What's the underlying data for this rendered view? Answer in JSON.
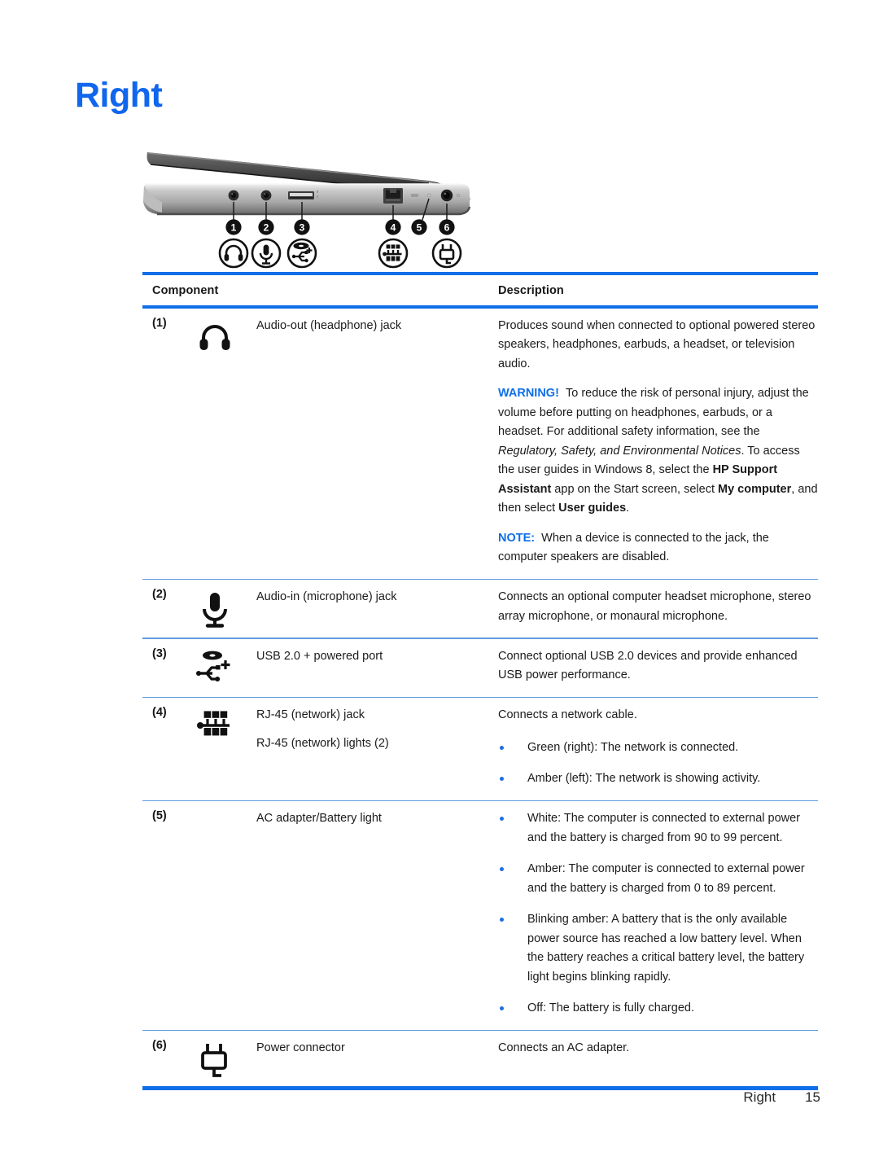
{
  "page": {
    "title": "Right",
    "title_color": "#1166EE",
    "accent_color": "#0E6FE8",
    "rule_color": "#5D9BE0",
    "footer_section": "Right",
    "footer_page_number": "15"
  },
  "illustration": {
    "alt": "Right side view of notebook computer showing six numbered callouts",
    "callouts": [
      "1",
      "2",
      "3",
      "4",
      "5",
      "6"
    ],
    "icon_names": [
      "headphone-icon",
      "microphone-icon",
      "usb-powered-icon",
      "rj45-network-icon",
      "power-connector-icon"
    ]
  },
  "table": {
    "headers": {
      "component": "Component",
      "description": "Description"
    },
    "rows": [
      {
        "callout": "(1)",
        "icon": "headphone-icon",
        "label": "Audio-out (headphone) jack",
        "label2": null,
        "paragraphs": [
          {
            "type": "plain",
            "text": "Produces sound when connected to optional powered stereo speakers, headphones, earbuds, a headset, or television audio."
          },
          {
            "type": "warning",
            "tag": "WARNING!",
            "text_1": "To reduce the risk of personal injury, adjust the volume before putting on headphones, earbuds, or a headset. For additional safety information, see the ",
            "italic_1": "Regulatory, Safety, and Environmental Notices",
            "text_2": ". To access the user guides in Windows 8, select the ",
            "bold_1": "HP Support Assistant",
            "text_3": " app on the Start screen, select ",
            "bold_2": "My computer",
            "text_4": ", and then select ",
            "bold_3": "User guides",
            "text_5": "."
          },
          {
            "type": "note",
            "tag": "NOTE:",
            "text": "When a device is connected to the jack, the computer speakers are disabled."
          }
        ],
        "bullets": []
      },
      {
        "callout": "(2)",
        "icon": "microphone-icon",
        "label": "Audio-in (microphone) jack",
        "label2": null,
        "paragraphs": [
          {
            "type": "plain",
            "text": "Connects an optional computer headset microphone, stereo array microphone, or monaural microphone."
          }
        ],
        "bullets": []
      },
      {
        "callout": "(3)",
        "icon": "usb-powered-icon",
        "label": "USB 2.0 + powered port",
        "label2": null,
        "paragraphs": [
          {
            "type": "plain",
            "text": "Connect optional USB 2.0 devices and provide enhanced USB power performance."
          }
        ],
        "bullets": []
      },
      {
        "callout": "(4)",
        "icon": "rj45-network-icon",
        "label": "RJ-45 (network) jack",
        "label2": "RJ-45 (network) lights (2)",
        "paragraphs": [
          {
            "type": "plain",
            "text": "Connects a network cable."
          }
        ],
        "bullets": [
          "Green (right): The network is connected.",
          "Amber (left): The network is showing activity."
        ]
      },
      {
        "callout": "(5)",
        "icon": null,
        "label": "AC adapter/Battery light",
        "label2": null,
        "paragraphs": [],
        "bullets": [
          "White: The computer is connected to external power and the battery is charged from 90 to 99 percent.",
          "Amber: The computer is connected to external power and the battery is charged from 0 to 89 percent.",
          "Blinking amber: A battery that is the only available power source has reached a low battery level. When the battery reaches a critical battery level, the battery light begins blinking rapidly.",
          "Off: The battery is fully charged."
        ]
      },
      {
        "callout": "(6)",
        "icon": "power-connector-icon",
        "label": "Power connector",
        "label2": null,
        "paragraphs": [
          {
            "type": "plain",
            "text": "Connects an AC adapter."
          }
        ],
        "bullets": []
      }
    ]
  }
}
